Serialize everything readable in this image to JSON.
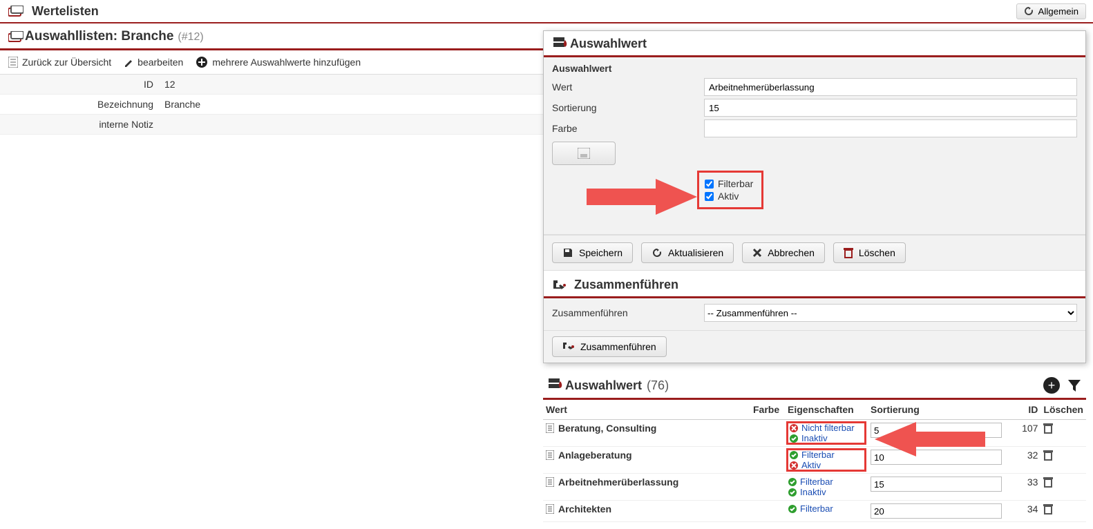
{
  "top": {
    "title": "Wertelisten",
    "allgemein": "Allgemein"
  },
  "left": {
    "panel_title": "Auswahllisten: Branche",
    "panel_count": "(#12)",
    "toolbar": {
      "back": "Zurück zur Übersicht",
      "edit": "bearbeiten",
      "addmulti": "mehrere Auswahlwerte hinzufügen"
    },
    "kv": [
      {
        "k": "ID",
        "v": "12"
      },
      {
        "k": "Bezeichnung",
        "v": "Branche"
      },
      {
        "k": "interne Notiz",
        "v": ""
      }
    ]
  },
  "popup": {
    "head": "Auswahlwert",
    "form_title": "Auswahlwert",
    "wert_label": "Wert",
    "wert_value": "Arbeitnehmerüberlassung",
    "sort_label": "Sortierung",
    "sort_value": "15",
    "farbe_label": "Farbe",
    "filterbar": "Filterbar",
    "aktiv": "Aktiv",
    "buttons": {
      "save": "Speichern",
      "refresh": "Aktualisieren",
      "cancel": "Abbrechen",
      "delete": "Löschen"
    },
    "merge_head": "Zusammenführen",
    "merge_label": "Zusammenführen",
    "merge_placeholder": "-- Zusammenführen --",
    "merge_btn": "Zusammenführen"
  },
  "list": {
    "head": "Auswahlwert",
    "count": "(76)",
    "cols": {
      "wert": "Wert",
      "farbe": "Farbe",
      "eig": "Eigenschaften",
      "sort": "Sortierung",
      "id": "ID",
      "del": "Löschen"
    },
    "rows": [
      {
        "wert": "Beratung, Consulting",
        "props": [
          {
            "ok": false,
            "t": "Nicht filterbar"
          },
          {
            "ok": true,
            "t": "Inaktiv"
          }
        ],
        "sort": "5",
        "id": "107",
        "highlight": true
      },
      {
        "wert": "Anlageberatung",
        "props": [
          {
            "ok": true,
            "t": "Filterbar"
          },
          {
            "ok": false,
            "t": "Aktiv"
          }
        ],
        "sort": "10",
        "id": "32",
        "highlight": true
      },
      {
        "wert": "Arbeitnehmerüberlassung",
        "props": [
          {
            "ok": true,
            "t": "Filterbar"
          },
          {
            "ok": true,
            "t": "Inaktiv"
          }
        ],
        "sort": "15",
        "id": "33"
      },
      {
        "wert": "Architekten",
        "props": [
          {
            "ok": true,
            "t": "Filterbar"
          }
        ],
        "sort": "20",
        "id": "34"
      }
    ]
  }
}
